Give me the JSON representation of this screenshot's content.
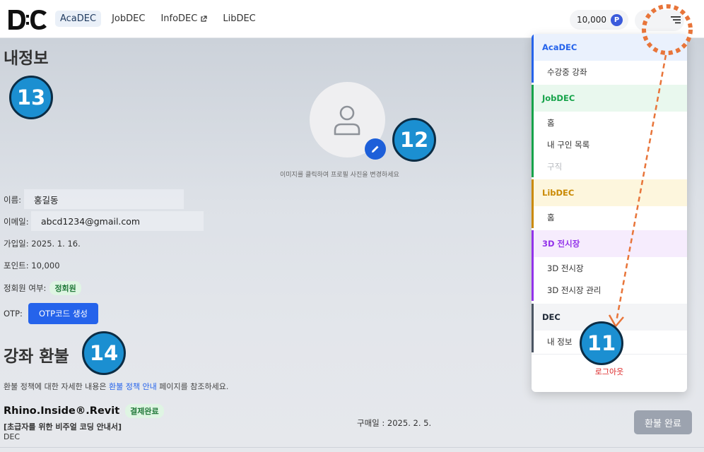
{
  "header": {
    "logo_text": "D:C",
    "nav": [
      {
        "label": "AcaDEC",
        "active": true
      },
      {
        "label": "JobDEC"
      },
      {
        "label": "InfoDEC",
        "external": true
      },
      {
        "label": "LibDEC"
      }
    ],
    "points": "10,000",
    "points_badge": "P"
  },
  "main": {
    "title": "내정보",
    "avatar_hint": "이미지를 클릭하여 프로필 사진을 변경하세요",
    "name_label": "이름:",
    "name_value": "홍길동",
    "email_label": "이메일:",
    "email_value": "abcd1234@gmail.com",
    "joined_label": "가입일: 2025. 1. 16.",
    "points_label": "포인트: 10,000",
    "member_label": "정회원 여부:",
    "member_value": "정회원",
    "otp_label": "OTP:",
    "otp_button": "OTP코드 생성"
  },
  "refund": {
    "title": "강좌 환불",
    "desc_before": "환불 정책에 대한 자세한 내용은 ",
    "desc_link": "환불 정책 안내",
    "desc_after": " 페이지를 참조하세요.",
    "course_name": "Rhino.Inside®.Revit",
    "course_status": "결제완료",
    "course_sub": "[초급자를 위한 비주얼 코딩 안내서]",
    "course_org": "DEC",
    "purchase_date": "구매일 : 2025. 2. 5.",
    "refund_button": "환불 완료"
  },
  "dropdown": {
    "sections": [
      {
        "title": "AcaDEC",
        "color": "#2563eb",
        "bg": "#eaf1fd",
        "items": [
          {
            "label": "수강중 강좌"
          }
        ]
      },
      {
        "title": "JobDEC",
        "color": "#16a34a",
        "bg": "#e9f8ee",
        "items": [
          {
            "label": "홈"
          },
          {
            "label": "내 구인 목록"
          },
          {
            "label": "구직",
            "disabled": true
          }
        ]
      },
      {
        "title": "LibDEC",
        "color": "#ca8a04",
        "bg": "#fdf6dd",
        "items": [
          {
            "label": "홈"
          }
        ]
      },
      {
        "title": "3D 전시장",
        "color": "#9333ea",
        "bg": "#f6ecfd",
        "items": [
          {
            "label": "3D 전시장"
          },
          {
            "label": "3D 전시장 관리"
          }
        ]
      },
      {
        "title": "DEC",
        "color": "#4b5563",
        "bg": "#f3f4f6",
        "items": [
          {
            "label": "내 정보"
          }
        ]
      }
    ],
    "logout": "로그아웃"
  },
  "callouts": [
    "11",
    "12",
    "13",
    "14"
  ],
  "colors": {
    "accent": "#2563eb",
    "callout": "#1b8fd1",
    "arrow": "#e8753a"
  }
}
